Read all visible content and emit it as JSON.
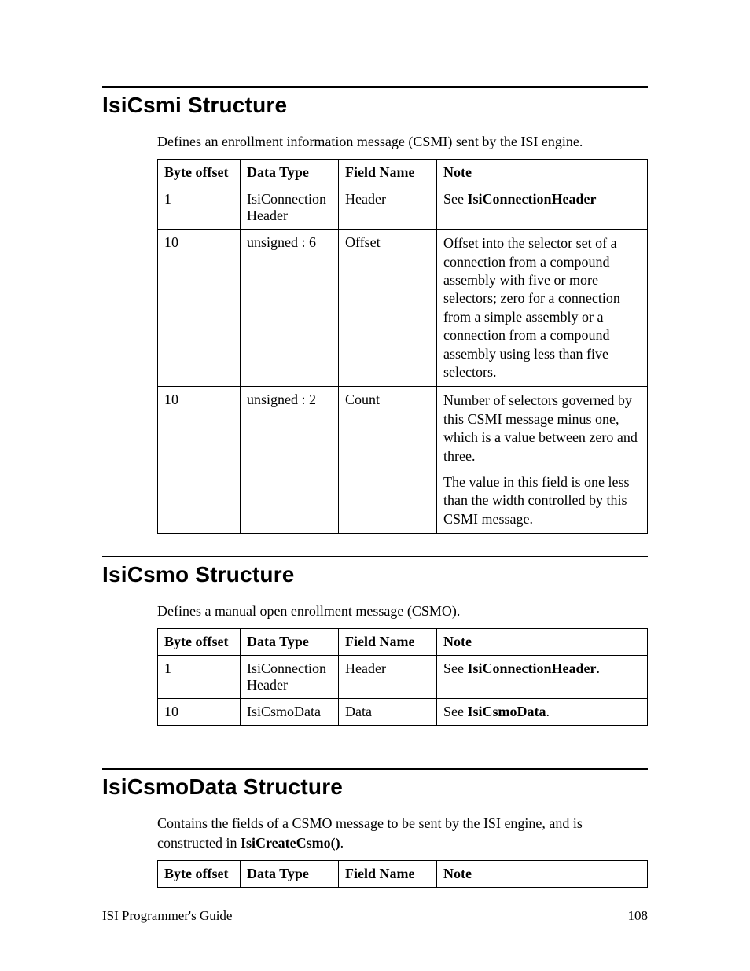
{
  "sections": [
    {
      "title": "IsiCsmi Structure",
      "desc_html": "Defines an enrollment information message (CSMI) sent by the ISI engine.",
      "headers": [
        "Byte offset",
        "Data Type",
        "Field Name",
        "Note"
      ],
      "rows": [
        {
          "offset": "1",
          "type": "IsiConnection Header",
          "field": "Header",
          "note_html": "See <span class=\"bold\">IsiConnectionHeader</span>"
        },
        {
          "offset": "10",
          "type": "unsigned : 6",
          "field": "Offset",
          "note_html": "<p class=\"note-para\">Offset into the selector set of a connection from a compound assembly with five or more selectors; zero for a connection from a simple assembly or a connection from a compound assembly using less than five selectors.</p>"
        },
        {
          "offset": "10",
          "type": "unsigned : 2",
          "field": "Count",
          "note_html": "<p class=\"note-para\">Number of selectors governed by this CSMI message minus one, which is a value between zero and three.</p><p class=\"note-para\">The value in this field is one less than the width controlled by this CSMI message.</p>"
        }
      ]
    },
    {
      "title": "IsiCsmo Structure",
      "desc_html": "Defines a manual open enrollment message (CSMO).",
      "headers": [
        "Byte offset",
        "Data Type",
        "Field Name",
        "Note"
      ],
      "rows": [
        {
          "offset": "1",
          "type": "IsiConnection Header",
          "field": "Header",
          "note_html": "See <span class=\"bold\">IsiConnectionHeader</span>."
        },
        {
          "offset": "10",
          "type": "IsiCsmoData",
          "field": "Data",
          "note_html": "See <span class=\"bold\">IsiCsmoData</span>."
        }
      ]
    },
    {
      "title": "IsiCsmoData Structure",
      "desc_html": "Contains the fields of a CSMO message to be sent by the ISI engine, and is constructed in <span class=\"bold\">IsiCreateCsmo()</span>.",
      "headers": [
        "Byte offset",
        "Data Type",
        "Field Name",
        "Note"
      ],
      "rows": []
    }
  ],
  "footer": {
    "left": "ISI Programmer's Guide",
    "right": "108"
  }
}
